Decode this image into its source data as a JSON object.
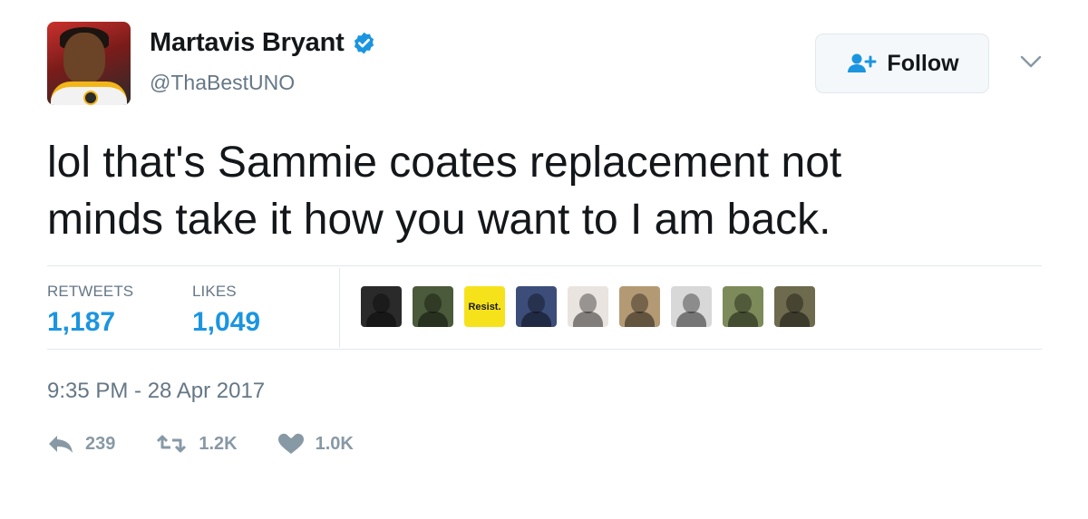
{
  "user": {
    "display_name": "Martavis Bryant",
    "handle": "@ThaBestUNO",
    "verified": true,
    "avatar_icon": "profile-photo"
  },
  "follow_button": {
    "label": "Follow",
    "icon": "add-user-icon"
  },
  "more_menu": {
    "icon": "chevron-down-icon"
  },
  "tweet": {
    "line1": "lol that's Sammie coates replacement not",
    "line2": "minds take it how you want to I am back."
  },
  "stats": {
    "retweets_label": "RETWEETS",
    "retweets_value": "1,187",
    "likes_label": "LIKES",
    "likes_value": "1,049"
  },
  "likers": [
    {
      "icon": "liker-avatar",
      "bg": "#2a2a2a"
    },
    {
      "icon": "liker-avatar",
      "bg": "#4a5a3a"
    },
    {
      "icon": "liker-avatar",
      "bg": "#f6e21b",
      "text": "Resist."
    },
    {
      "icon": "liker-avatar",
      "bg": "#3c4d7a"
    },
    {
      "icon": "liker-avatar",
      "bg": "#e9e4df"
    },
    {
      "icon": "liker-avatar",
      "bg": "#b49a74"
    },
    {
      "icon": "liker-avatar",
      "bg": "#d8d8d8"
    },
    {
      "icon": "liker-avatar",
      "bg": "#7d8a5a"
    },
    {
      "icon": "liker-avatar",
      "bg": "#6e6a4e"
    }
  ],
  "timestamp": "9:35 PM - 28 Apr 2017",
  "actions": {
    "reply_count": "239",
    "retweet_count": "1.2K",
    "like_count": "1.0K"
  },
  "colors": {
    "link_blue": "#1b95e0",
    "secondary_text": "#657786",
    "icon_gray": "#8899a6",
    "divider": "#e1e8ed"
  }
}
